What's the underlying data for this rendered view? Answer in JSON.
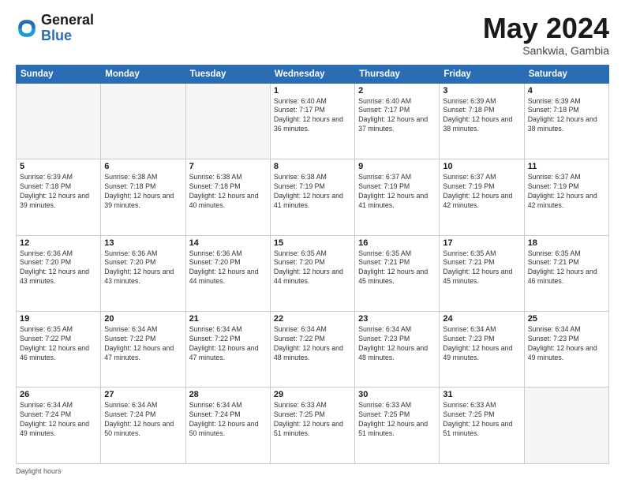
{
  "header": {
    "logo_general": "General",
    "logo_blue": "Blue",
    "month": "May 2024",
    "location": "Sankwia, Gambia"
  },
  "weekdays": [
    "Sunday",
    "Monday",
    "Tuesday",
    "Wednesday",
    "Thursday",
    "Friday",
    "Saturday"
  ],
  "weeks": [
    [
      {
        "day": "",
        "info": ""
      },
      {
        "day": "",
        "info": ""
      },
      {
        "day": "",
        "info": ""
      },
      {
        "day": "1",
        "info": "Sunrise: 6:40 AM\nSunset: 7:17 PM\nDaylight: 12 hours and 36 minutes."
      },
      {
        "day": "2",
        "info": "Sunrise: 6:40 AM\nSunset: 7:17 PM\nDaylight: 12 hours and 37 minutes."
      },
      {
        "day": "3",
        "info": "Sunrise: 6:39 AM\nSunset: 7:18 PM\nDaylight: 12 hours and 38 minutes."
      },
      {
        "day": "4",
        "info": "Sunrise: 6:39 AM\nSunset: 7:18 PM\nDaylight: 12 hours and 38 minutes."
      }
    ],
    [
      {
        "day": "5",
        "info": "Sunrise: 6:39 AM\nSunset: 7:18 PM\nDaylight: 12 hours and 39 minutes."
      },
      {
        "day": "6",
        "info": "Sunrise: 6:38 AM\nSunset: 7:18 PM\nDaylight: 12 hours and 39 minutes."
      },
      {
        "day": "7",
        "info": "Sunrise: 6:38 AM\nSunset: 7:18 PM\nDaylight: 12 hours and 40 minutes."
      },
      {
        "day": "8",
        "info": "Sunrise: 6:38 AM\nSunset: 7:19 PM\nDaylight: 12 hours and 41 minutes."
      },
      {
        "day": "9",
        "info": "Sunrise: 6:37 AM\nSunset: 7:19 PM\nDaylight: 12 hours and 41 minutes."
      },
      {
        "day": "10",
        "info": "Sunrise: 6:37 AM\nSunset: 7:19 PM\nDaylight: 12 hours and 42 minutes."
      },
      {
        "day": "11",
        "info": "Sunrise: 6:37 AM\nSunset: 7:19 PM\nDaylight: 12 hours and 42 minutes."
      }
    ],
    [
      {
        "day": "12",
        "info": "Sunrise: 6:36 AM\nSunset: 7:20 PM\nDaylight: 12 hours and 43 minutes."
      },
      {
        "day": "13",
        "info": "Sunrise: 6:36 AM\nSunset: 7:20 PM\nDaylight: 12 hours and 43 minutes."
      },
      {
        "day": "14",
        "info": "Sunrise: 6:36 AM\nSunset: 7:20 PM\nDaylight: 12 hours and 44 minutes."
      },
      {
        "day": "15",
        "info": "Sunrise: 6:35 AM\nSunset: 7:20 PM\nDaylight: 12 hours and 44 minutes."
      },
      {
        "day": "16",
        "info": "Sunrise: 6:35 AM\nSunset: 7:21 PM\nDaylight: 12 hours and 45 minutes."
      },
      {
        "day": "17",
        "info": "Sunrise: 6:35 AM\nSunset: 7:21 PM\nDaylight: 12 hours and 45 minutes."
      },
      {
        "day": "18",
        "info": "Sunrise: 6:35 AM\nSunset: 7:21 PM\nDaylight: 12 hours and 46 minutes."
      }
    ],
    [
      {
        "day": "19",
        "info": "Sunrise: 6:35 AM\nSunset: 7:22 PM\nDaylight: 12 hours and 46 minutes."
      },
      {
        "day": "20",
        "info": "Sunrise: 6:34 AM\nSunset: 7:22 PM\nDaylight: 12 hours and 47 minutes."
      },
      {
        "day": "21",
        "info": "Sunrise: 6:34 AM\nSunset: 7:22 PM\nDaylight: 12 hours and 47 minutes."
      },
      {
        "day": "22",
        "info": "Sunrise: 6:34 AM\nSunset: 7:22 PM\nDaylight: 12 hours and 48 minutes."
      },
      {
        "day": "23",
        "info": "Sunrise: 6:34 AM\nSunset: 7:23 PM\nDaylight: 12 hours and 48 minutes."
      },
      {
        "day": "24",
        "info": "Sunrise: 6:34 AM\nSunset: 7:23 PM\nDaylight: 12 hours and 49 minutes."
      },
      {
        "day": "25",
        "info": "Sunrise: 6:34 AM\nSunset: 7:23 PM\nDaylight: 12 hours and 49 minutes."
      }
    ],
    [
      {
        "day": "26",
        "info": "Sunrise: 6:34 AM\nSunset: 7:24 PM\nDaylight: 12 hours and 49 minutes."
      },
      {
        "day": "27",
        "info": "Sunrise: 6:34 AM\nSunset: 7:24 PM\nDaylight: 12 hours and 50 minutes."
      },
      {
        "day": "28",
        "info": "Sunrise: 6:34 AM\nSunset: 7:24 PM\nDaylight: 12 hours and 50 minutes."
      },
      {
        "day": "29",
        "info": "Sunrise: 6:33 AM\nSunset: 7:25 PM\nDaylight: 12 hours and 51 minutes."
      },
      {
        "day": "30",
        "info": "Sunrise: 6:33 AM\nSunset: 7:25 PM\nDaylight: 12 hours and 51 minutes."
      },
      {
        "day": "31",
        "info": "Sunrise: 6:33 AM\nSunset: 7:25 PM\nDaylight: 12 hours and 51 minutes."
      },
      {
        "day": "",
        "info": ""
      }
    ]
  ],
  "footer": {
    "daylight_hours": "Daylight hours"
  }
}
